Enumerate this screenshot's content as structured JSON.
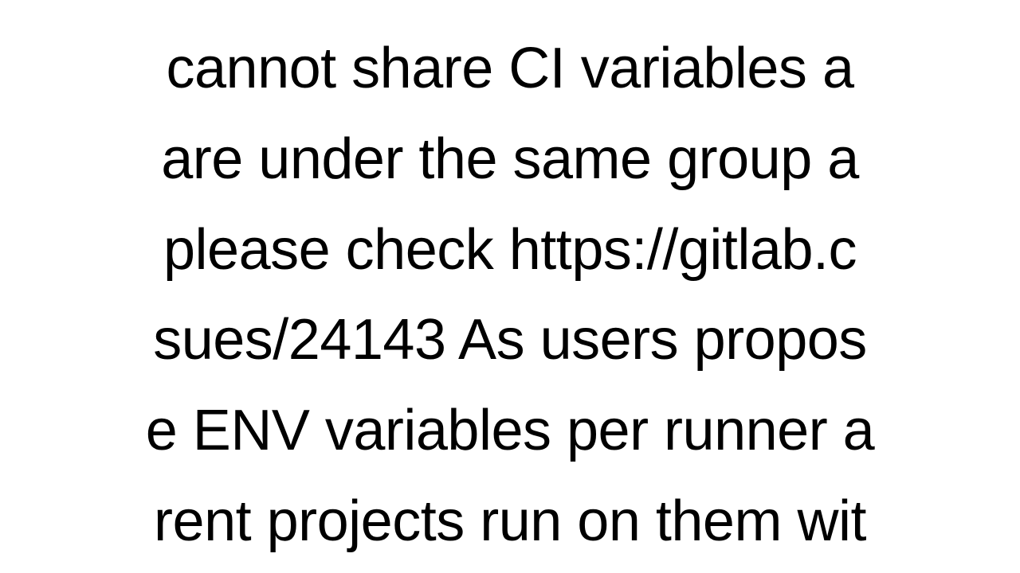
{
  "document": {
    "line1": "cannot share CI variables a",
    "line2": "are under the same group a",
    "line3": "please check https://gitlab.c",
    "line4": "sues/24143 As users propos",
    "line5": "e ENV variables per runner a",
    "line6": "rent projects run on them wit"
  }
}
